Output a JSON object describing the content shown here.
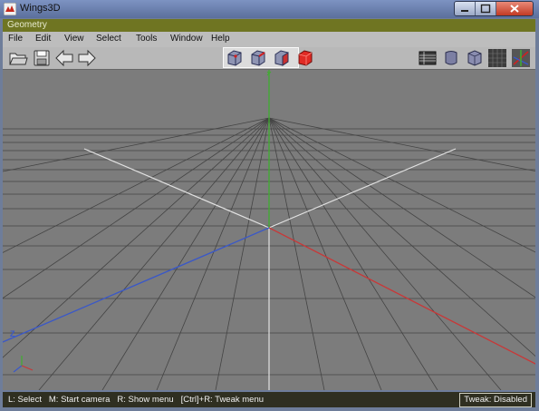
{
  "window": {
    "title": "Wings3D"
  },
  "geometry_bar": {
    "label": "Geometry"
  },
  "menu": {
    "items": [
      {
        "label": "File"
      },
      {
        "label": "Edit"
      },
      {
        "label": "View"
      },
      {
        "label": "Select"
      },
      {
        "label": "Tools"
      },
      {
        "label": "Window"
      },
      {
        "label": "Help"
      }
    ]
  },
  "toolbar": {
    "left_icons": [
      "open-folder-icon",
      "save-disk-icon",
      "undo-arrow-icon",
      "redo-arrow-icon"
    ],
    "selection_modes": [
      "vertex-mode-icon",
      "edge-mode-icon",
      "face-mode-icon",
      "body-mode-icon"
    ],
    "selected_mode": "body-mode-icon",
    "right_icons": [
      "grid-toggle-icon",
      "smooth-shade-icon",
      "flat-shade-icon",
      "wireframe-icon",
      "axes-toggle-icon"
    ]
  },
  "viewport": {
    "axis_colors": {
      "x": "#c83838",
      "y": "#3fae2f",
      "z": "#3a58c8"
    },
    "axis_label_z": "Z",
    "grid": true
  },
  "status": {
    "message": "L: Select   M: Start camera   R: Show menu   [Ctrl]+R: Tweak menu",
    "tweak": "Tweak: Disabled"
  }
}
